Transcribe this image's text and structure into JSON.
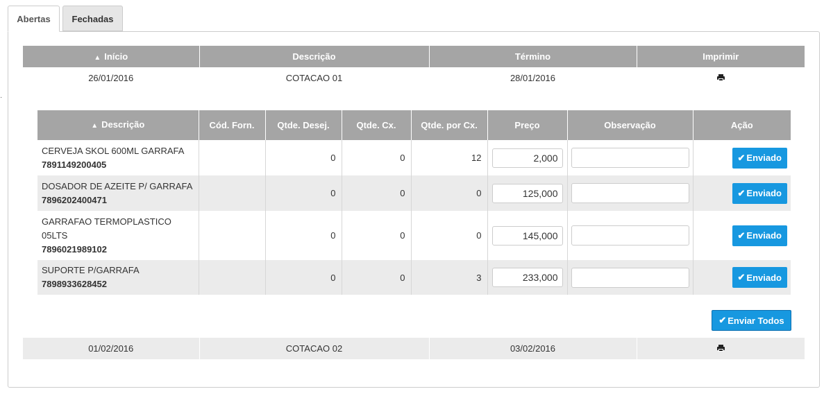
{
  "tabs": {
    "open": "Abertas",
    "closed": "Fechadas"
  },
  "stray_mark": "·",
  "quotes_table": {
    "headers": {
      "start": "Início",
      "description": "Descrição",
      "end": "Término",
      "print": "Imprimir"
    },
    "rows": [
      {
        "start": "26/01/2016",
        "description": "COTACAO 01",
        "end": "28/01/2016",
        "print_icon": "printer-icon"
      },
      {
        "start": "01/02/2016",
        "description": "COTACAO 02",
        "end": "03/02/2016",
        "print_icon": "printer-icon"
      }
    ]
  },
  "items_table": {
    "headers": {
      "description": "Descrição",
      "supplier_code": "Cód. Forn.",
      "qty_desired": "Qtde. Desej.",
      "qty_box": "Qtde. Cx.",
      "qty_per_box": "Qtde. por Cx.",
      "price": "Preço",
      "note": "Observação",
      "action": "Ação"
    },
    "rows": [
      {
        "name": "CERVEJA SKOL 600ML GARRAFA",
        "code": "7891149200405",
        "supplier_code": "",
        "qty_desired": "0",
        "qty_box": "0",
        "qty_per_box": "12",
        "price": "2,000",
        "note": "",
        "action": "Enviado"
      },
      {
        "name": "DOSADOR DE AZEITE P/ GARRAFA",
        "code": "7896202400471",
        "supplier_code": "",
        "qty_desired": "0",
        "qty_box": "0",
        "qty_per_box": "0",
        "price": "125,000",
        "note": "",
        "action": "Enviado"
      },
      {
        "name": "GARRAFAO TERMOPLASTICO 05LTS",
        "code": "7896021989102",
        "supplier_code": "",
        "qty_desired": "0",
        "qty_box": "0",
        "qty_per_box": "0",
        "price": "145,000",
        "note": "",
        "action": "Enviado"
      },
      {
        "name": "SUPORTE P/GARRAFA",
        "code": "7898933628452",
        "supplier_code": "",
        "qty_desired": "0",
        "qty_box": "0",
        "qty_per_box": "3",
        "price": "233,000",
        "note": "",
        "action": "Enviado"
      }
    ],
    "send_all": "Enviar Todos"
  },
  "colors": {
    "header_bg": "#a5a5a5",
    "button_bg": "#1798e0",
    "row_alt": "#ebebeb"
  }
}
